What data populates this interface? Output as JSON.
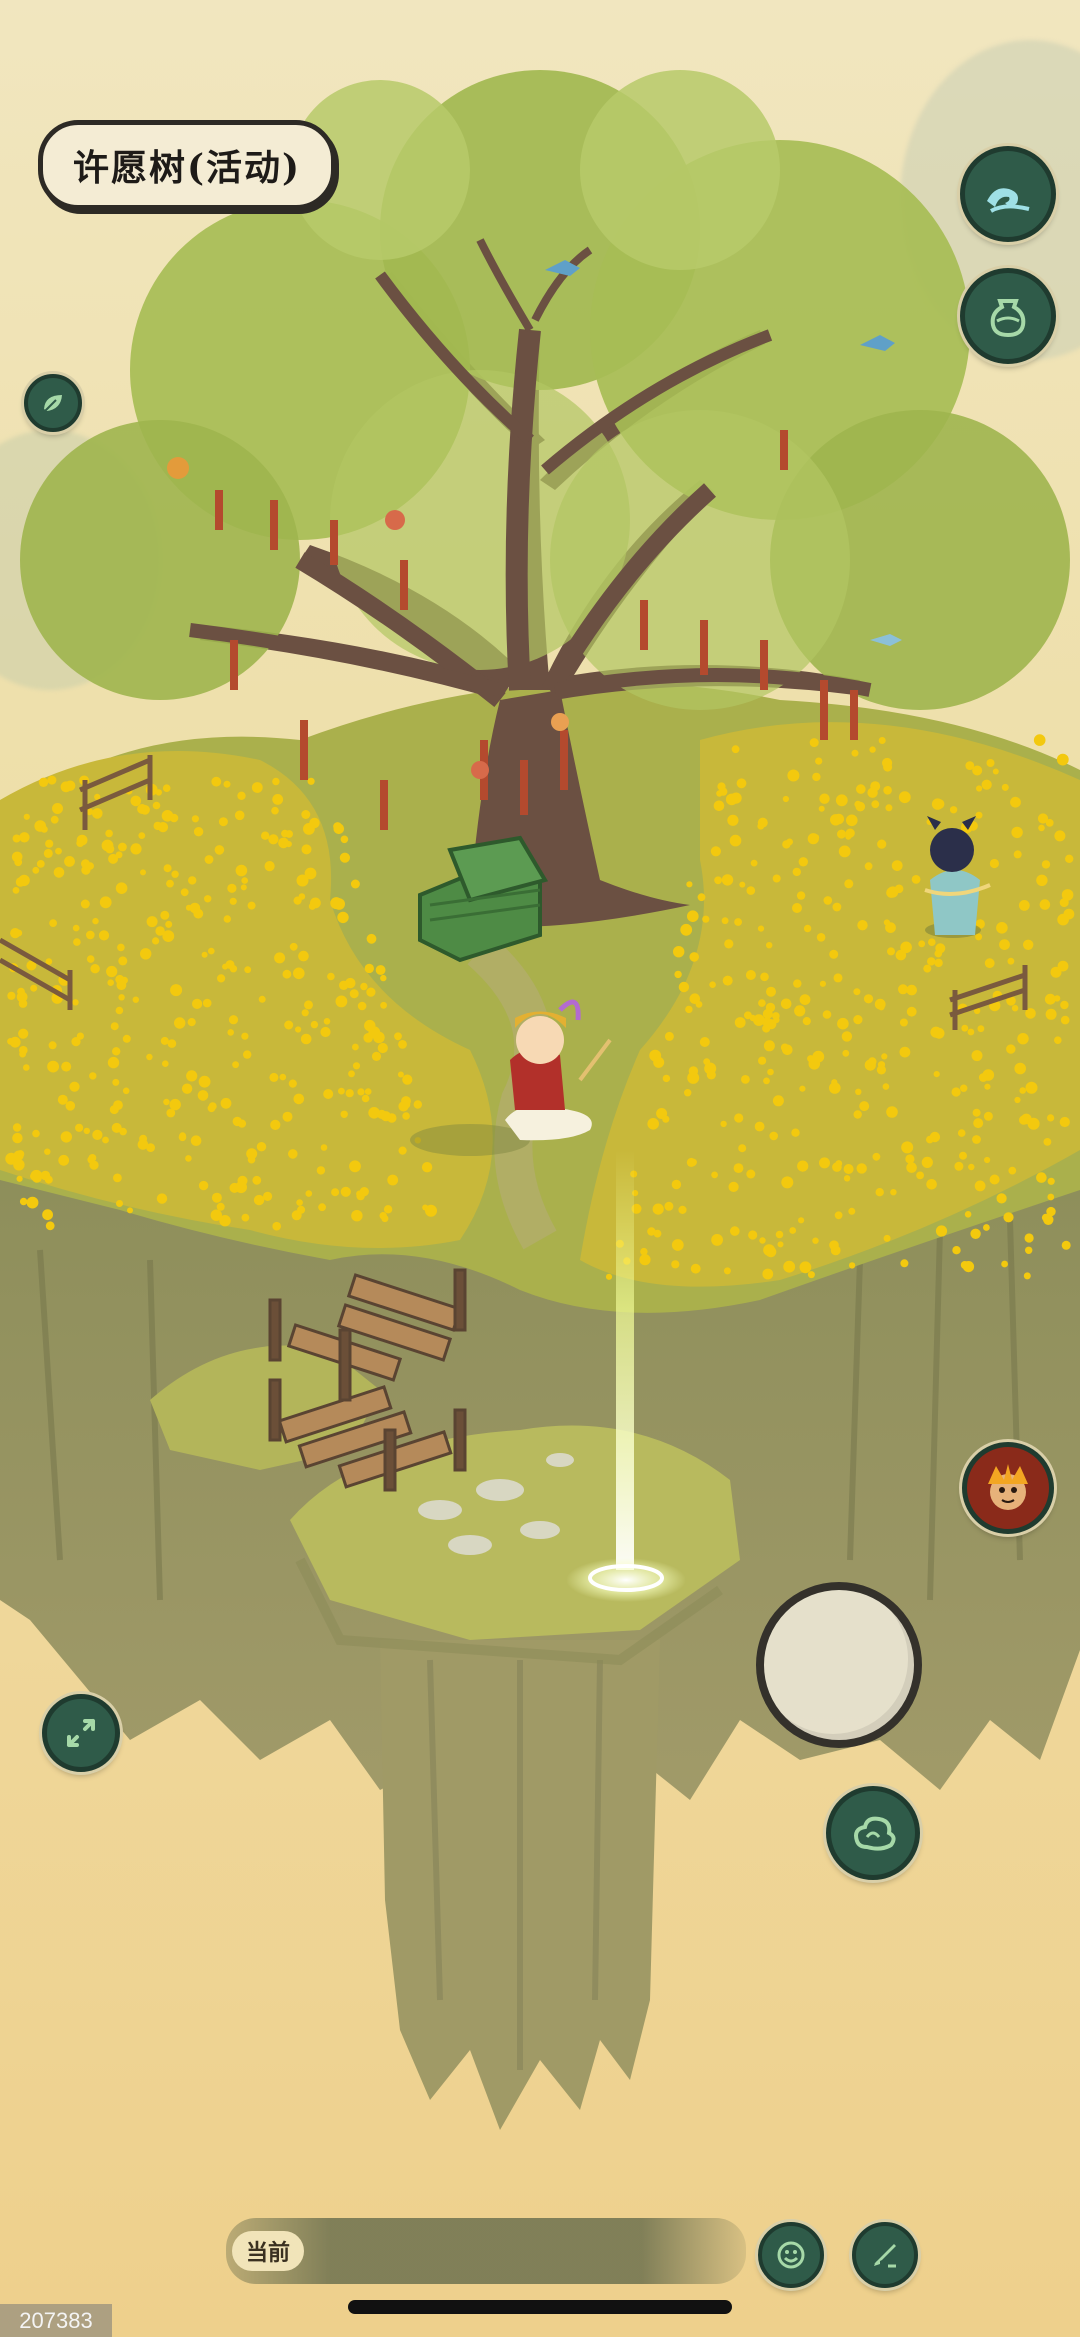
{
  "location": {
    "title": "许愿树(活动)"
  },
  "buttons": {
    "wave_icon": "wave-icon",
    "jar_icon": "jar-icon",
    "leaf_icon": "leaf-icon",
    "expand_icon": "expand-icon",
    "cloud_icon": "cloud-icon",
    "emote_icon": "smile-icon",
    "chat_icon": "brush-icon",
    "monkey_king_icon": "monkey-king-icon"
  },
  "chat": {
    "channel_label": "当前"
  },
  "build": {
    "id": "207383"
  },
  "colors": {
    "button_fill": "#2f5b49",
    "button_border": "#1f3b2f",
    "flowers": "#f3c90e",
    "grass": "#a8b04a",
    "cliff": "#8f8f5c",
    "tree_foliage": "#9fb54e",
    "trunk": "#6b5042",
    "ribbons": "#b44a2e",
    "beam": "#f4ff9a"
  }
}
